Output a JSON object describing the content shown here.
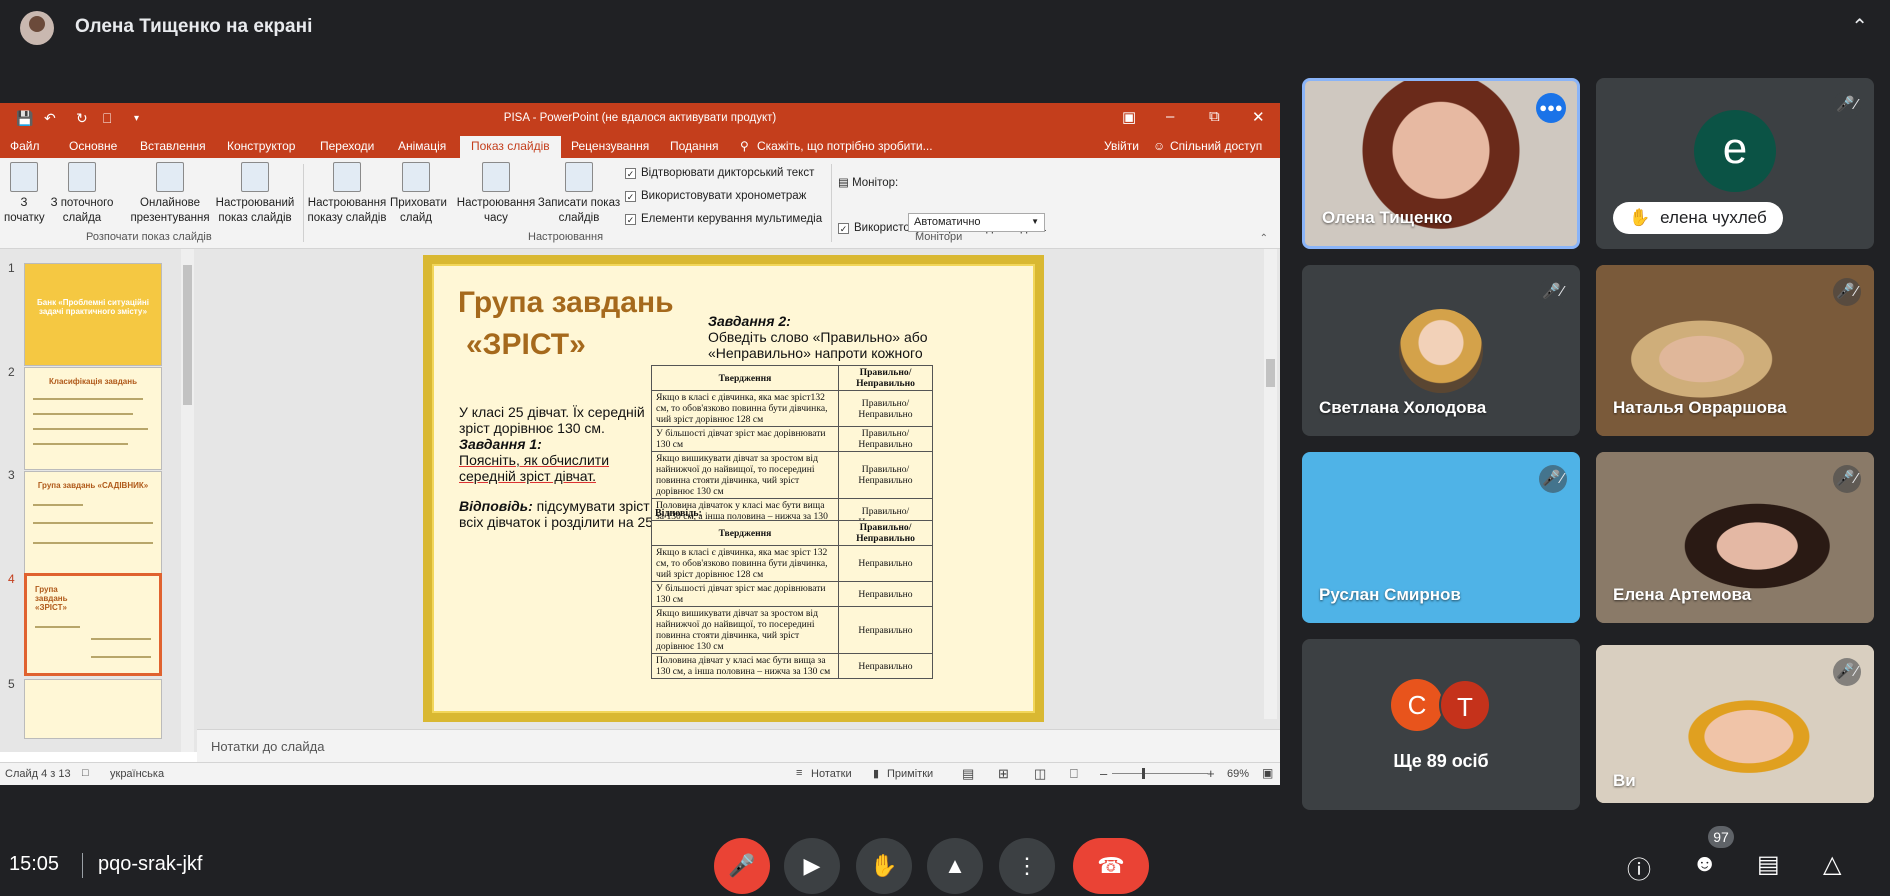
{
  "meet": {
    "presenter_title": "Олена Тищенко на екрані",
    "time": "15:05",
    "meeting_code": "pqo-srak-jkf",
    "participants_badge": "97",
    "others_label": "Ще 89 осіб",
    "participants": [
      {
        "name": "Олена Тищенко"
      },
      {
        "name": "елена чухлеб",
        "initial": "е"
      },
      {
        "name": "Светлана Холодова"
      },
      {
        "name": "Наталья Овраршова"
      },
      {
        "name": "Руслан Смирнов"
      },
      {
        "name": "Елена Артемова"
      },
      {
        "name": "Ви"
      }
    ],
    "others_initials": [
      "С",
      "Т"
    ],
    "colors": {
      "accent": "#1a73e8",
      "end_call": "#ea4335",
      "bg": "#202124"
    }
  },
  "ppt": {
    "window_title": "PISA - PowerPoint (не вдалося активувати продукт)",
    "tabs": [
      "Файл",
      "Основне",
      "Вставлення",
      "Конструктор",
      "Переходи",
      "Анімація",
      "Показ слайдів",
      "Рецензування",
      "Подання"
    ],
    "tell_me": "Скажіть, що потрібно зробити...",
    "signin": "Увійти",
    "share": "Спільний доступ",
    "ribbon": {
      "from_start": "З початку",
      "from_current": "З поточного слайда",
      "online": "Онлайнове презентування",
      "custom": "Настроюваний показ слайдів",
      "group_start": "Розпочати показ слайдів",
      "setup": "Настроювання показу слайдів",
      "hide": "Приховати слайд",
      "rehearse": "Настроювання часу",
      "record": "Записати показ слайдів",
      "chk_narration": "Відтворювати дикторський текст",
      "chk_timings": "Використовувати хронометраж",
      "chk_media": "Елементи керування мультимедіа",
      "group_setup": "Настроювання",
      "monitor_label": "Монітор:",
      "monitor_value": "Автоматично",
      "chk_presenter": "Використовувати режим доповідача",
      "group_monitors": "Монітори"
    },
    "thumb_titles": [
      "Банк «Проблемні ситуаційні задачі практичного змісту»",
      "Класифікація завдань",
      "Група завдань «САДІВНИК»",
      "Група завдань «ЗРІСТ»"
    ],
    "notes_placeholder": "Нотатки до слайда",
    "status": {
      "slide_num": "Слайд 4 з 13",
      "language": "українська",
      "notes": "Нотатки",
      "comments": "Примітки",
      "zoom": "69%"
    },
    "slide": {
      "title_line1": "Група завдань",
      "title_line2": "«ЗРІСТ»",
      "text1": "У класі 25 дівчат. Їх середній зріст дорівнює 130 см.",
      "task1_label": "Завдання 1:",
      "task1_text": "Поясніть, як обчислити середній зріст дівчат.",
      "answer_label": "Відповідь:",
      "answer_text": "підсумувати зріст всіх дівчаток і розділити на 25.",
      "task2_label": "Завдання 2:",
      "task2_text": "Обведіть слово «Правильно» або «Неправильно» напроти кожного твердження.",
      "table_headers": [
        "Твердження",
        "Правильно/ Неправильно"
      ],
      "statements": [
        "Якщо в класі є дівчинка, яка має зріст132 см, то обов'язково повинна бути дівчинка, чий зріст дорівнює 128 см",
        "У більшості дівчат зріст має дорівнювати 130 см",
        "Якщо вишикувати дівчат за зростом від найнижчої до найвищої, то посередині повинна стояти дівчинка, чий зріст дорівнює 130 см",
        "Половина дівчаток у класі має бути вища за 130 см, а інша половина – нижча за 130 см"
      ],
      "choice": "Правильно/ Неправильно",
      "answers_label": "Відповідь:",
      "answer_statements": [
        "Якщо в класі є дівчинка, яка має зріст 132 см, то обов'язково повинна бути дівчинка, чий зріст дорівнює 128 см",
        "У більшості дівчат зріст має дорівнювати 130 см",
        "Якщо вишикувати дівчат за зростом від найнижчої до найвищої, то посередині повинна стояти дівчинка, чий зріст дорівнює 130 см",
        "Половина дівчат у класі має бути вища за 130 см, а інша половина – нижча за 130 см"
      ],
      "answer_value": "Неправильно"
    }
  }
}
